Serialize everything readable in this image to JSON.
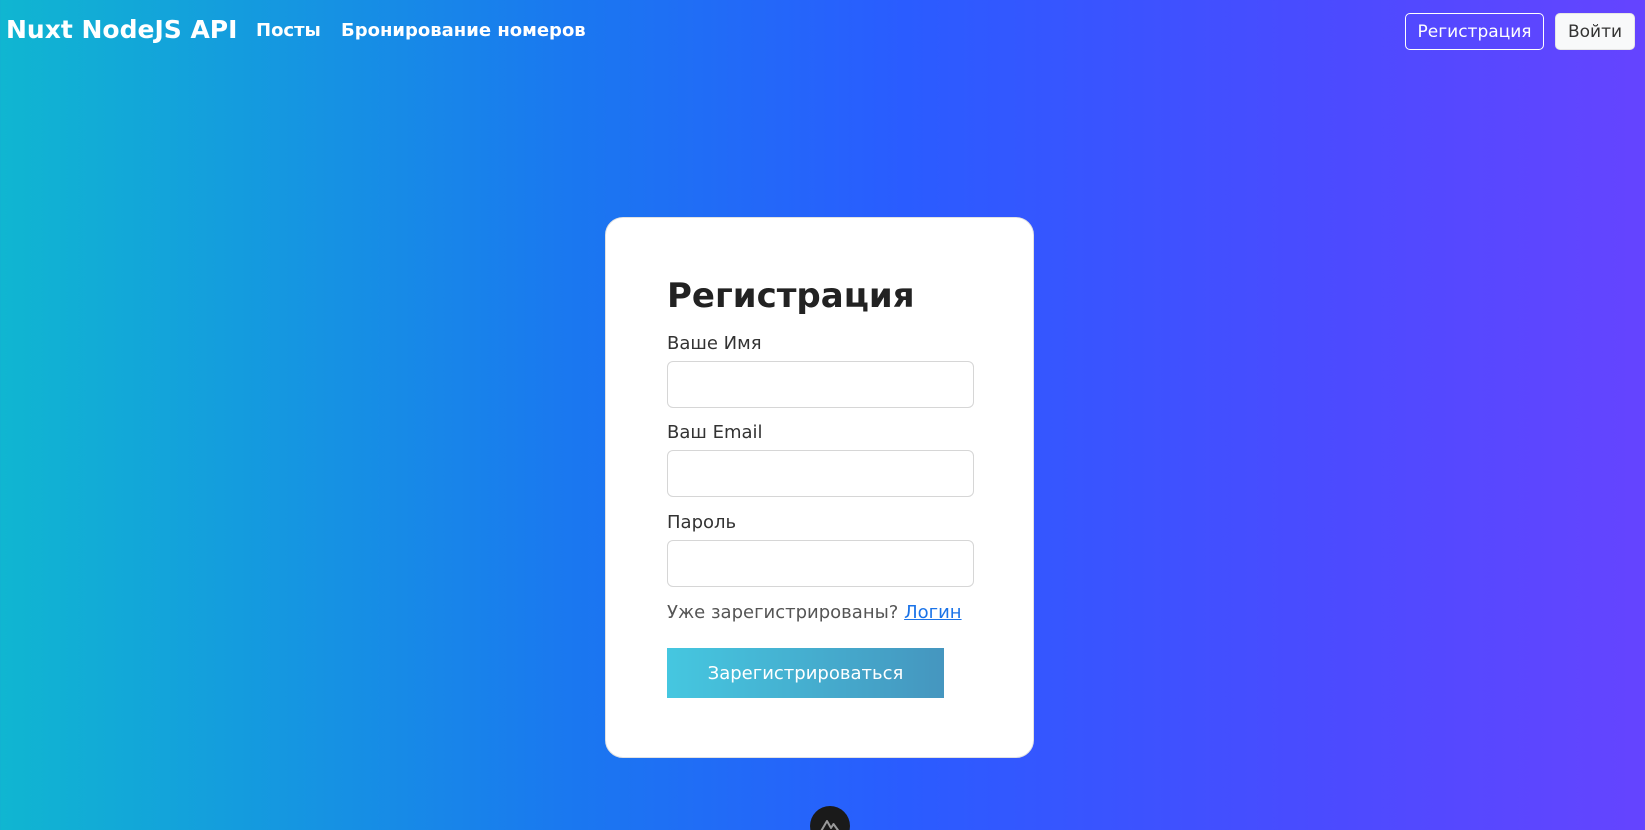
{
  "navbar": {
    "brand": "Nuxt NodeJS API",
    "links": [
      {
        "label": "Посты"
      },
      {
        "label": "Бронирование номеров"
      }
    ],
    "register_button": "Регистрация",
    "login_button": "Войти"
  },
  "form": {
    "title": "Регистрация",
    "name_label": "Ваше Имя",
    "name_value": "",
    "email_label": "Ваш Email",
    "email_value": "",
    "password_label": "Пароль",
    "password_value": "",
    "already_text": "Уже зарегистрированы?",
    "login_link": "Логин",
    "submit_label": "Зарегистрироваться"
  },
  "icons": {
    "nuxt_badge": "nuxt-logo-icon"
  },
  "colors": {
    "gradient_start": "#10b6d1",
    "gradient_mid": "#2a5cff",
    "gradient_end": "#6544ff",
    "link": "#1a73e8",
    "submit_start": "#45c7e0",
    "submit_end": "#4596bf"
  }
}
